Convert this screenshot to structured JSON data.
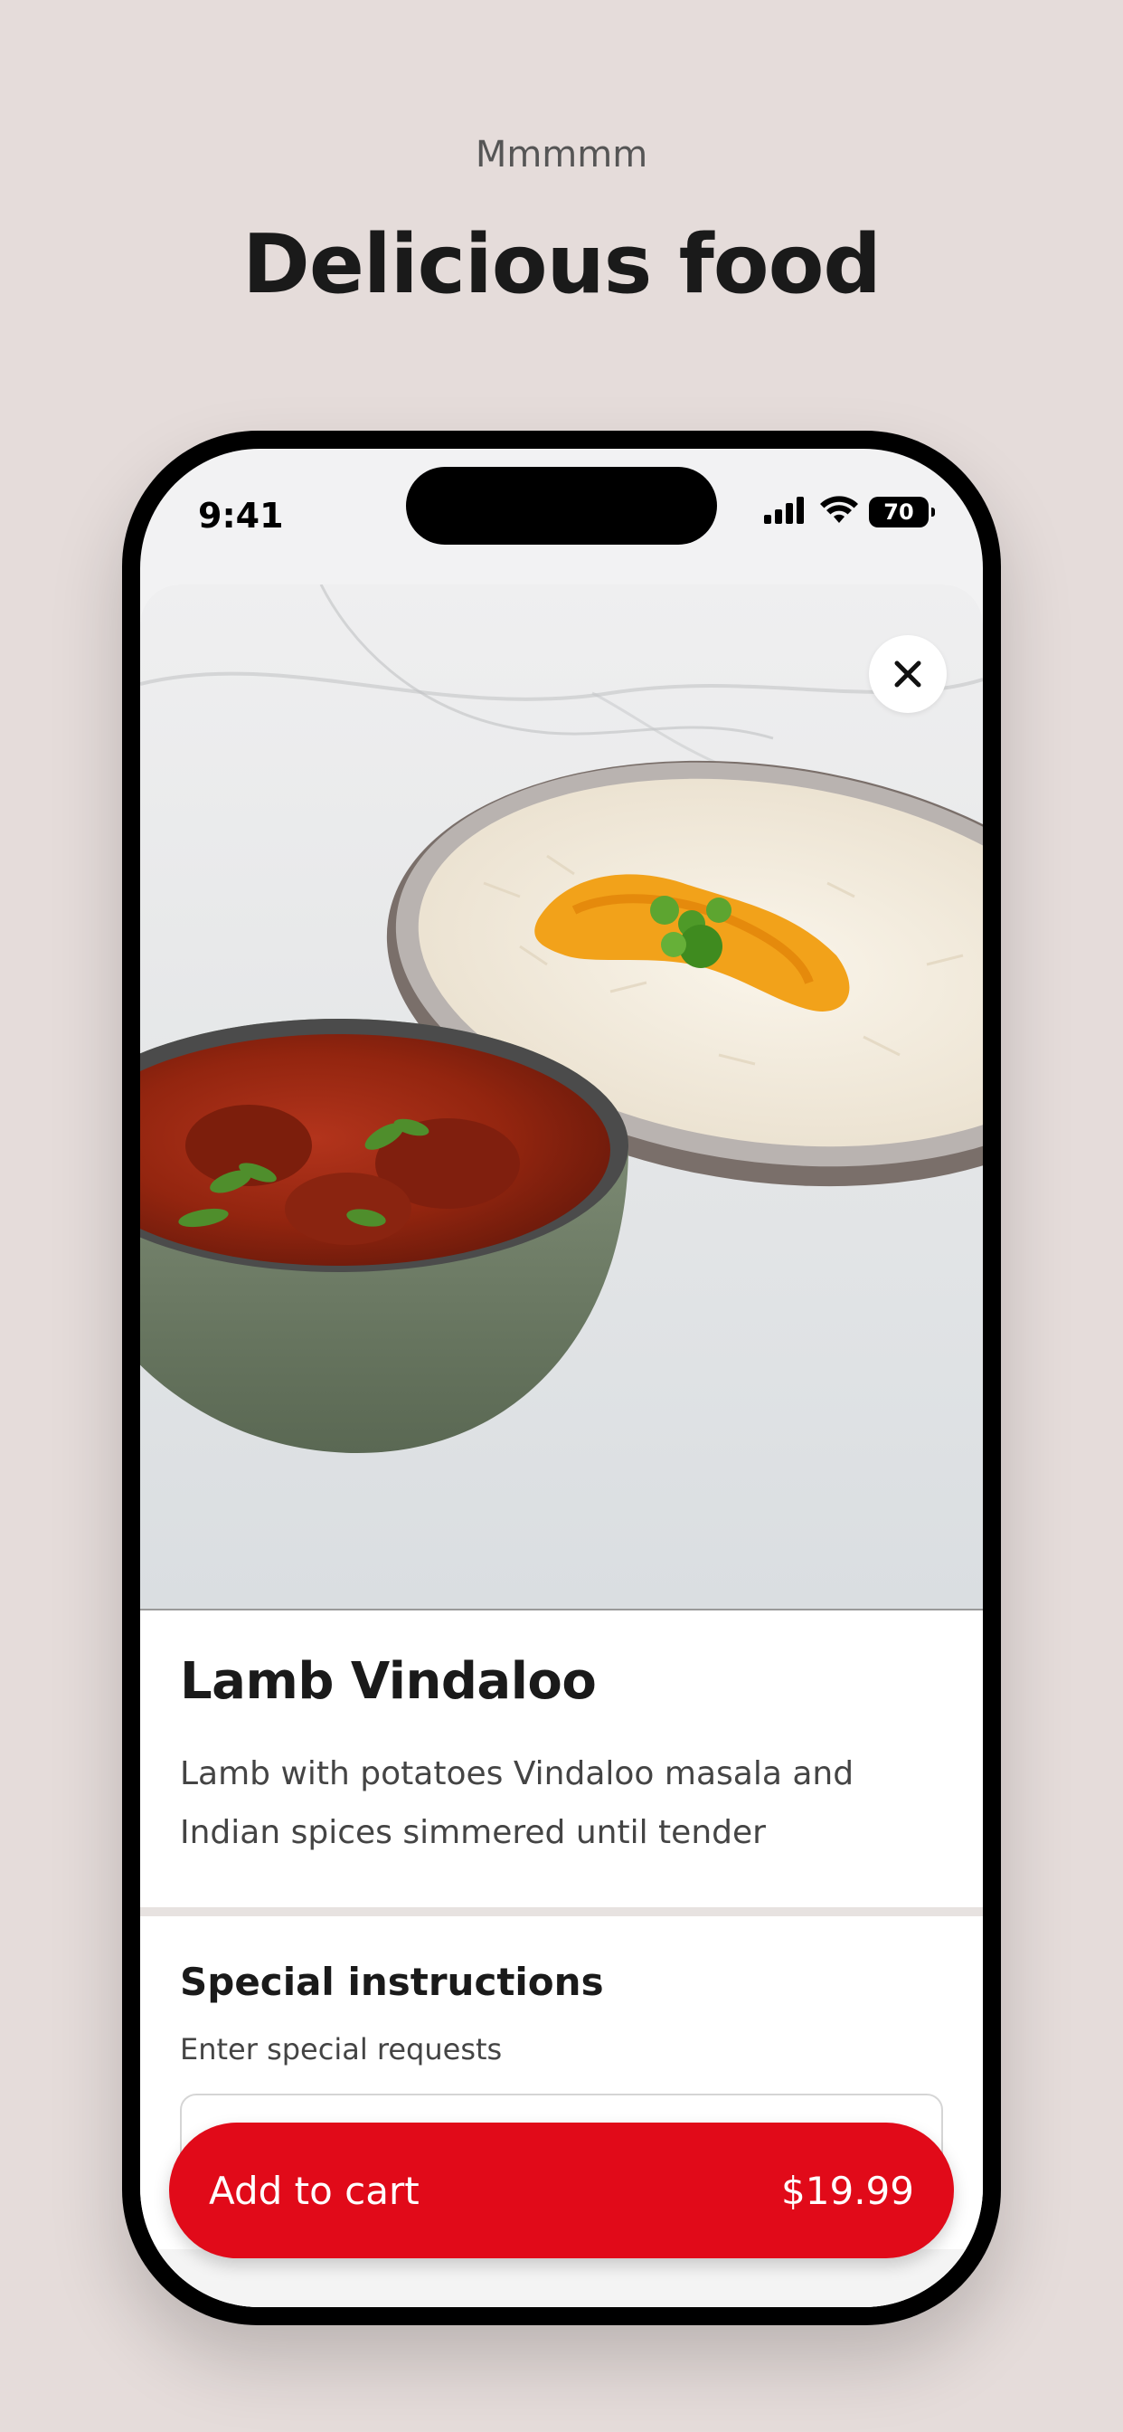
{
  "header": {
    "kicker": "Mmmmm",
    "title": "Delicious food"
  },
  "status_bar": {
    "time": "9:41",
    "battery": "70",
    "icons": [
      "cellular-signal-icon",
      "wifi-icon",
      "battery-icon"
    ]
  },
  "item": {
    "image_alt": "Lamb vindaloo in a green bowl with saffron rice and peas",
    "title": "Lamb Vindaloo",
    "description": "Lamb with potatoes Vindaloo masala and Indian spices simmered until tender"
  },
  "instructions": {
    "title": "Special instructions",
    "subtitle": "Enter special requests",
    "value": ""
  },
  "cart": {
    "label": "Add to cart",
    "price": "$19.99"
  },
  "colors": {
    "background": "#E5DCDA",
    "accent": "#E10A19",
    "text": "#1a1a1a"
  }
}
